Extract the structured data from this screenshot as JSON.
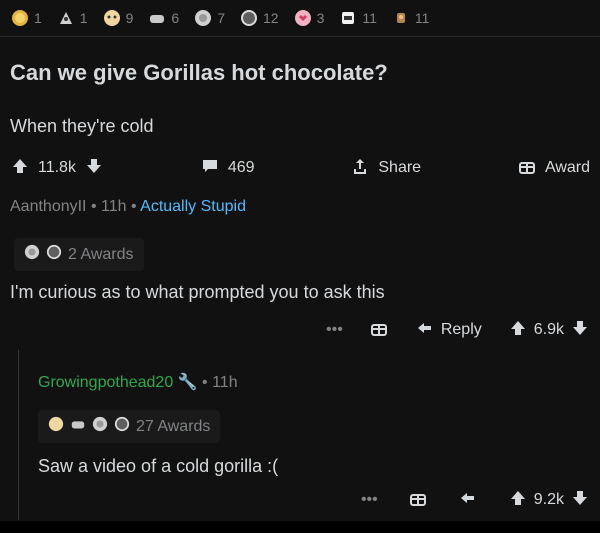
{
  "awards_row": [
    {
      "icon": "gold-badge-icon",
      "count": "1"
    },
    {
      "icon": "rocket-icon",
      "count": "1"
    },
    {
      "icon": "wholesome-seal-icon",
      "count": "9"
    },
    {
      "icon": "reaching-hands-icon",
      "count": "6"
    },
    {
      "icon": "silver-award-icon",
      "count": "7"
    },
    {
      "icon": "s-coin-icon",
      "count": "12"
    },
    {
      "icon": "heart-eyes-icon",
      "count": "3"
    },
    {
      "icon": "bee-sticker-icon",
      "count": "11"
    },
    {
      "icon": "trophy-character-icon",
      "count": "11"
    }
  ],
  "post": {
    "title": "Can we give Gorillas hot chocolate?",
    "body": "When they're cold",
    "upvotes": "11.8k",
    "comments": "469",
    "share_label": "Share",
    "award_label": "Award"
  },
  "comment1": {
    "author": "AanthonyII",
    "time": "11h",
    "flair": "Actually Stupid",
    "awards_label": "2 Awards",
    "text": "I'm curious as to what prompted you to ask this",
    "reply_label": "Reply",
    "votes": "6.9k"
  },
  "comment2": {
    "author": "Growingpothead20",
    "time": "11h",
    "awards_label": "27 Awards",
    "text": "Saw a video of a cold gorilla :(",
    "votes": "9.2k"
  },
  "colors": {
    "background": "#111111",
    "text": "#d7dadc",
    "muted": "#818384",
    "flair": "#4fbcff",
    "username_green": "#2ea84f"
  }
}
